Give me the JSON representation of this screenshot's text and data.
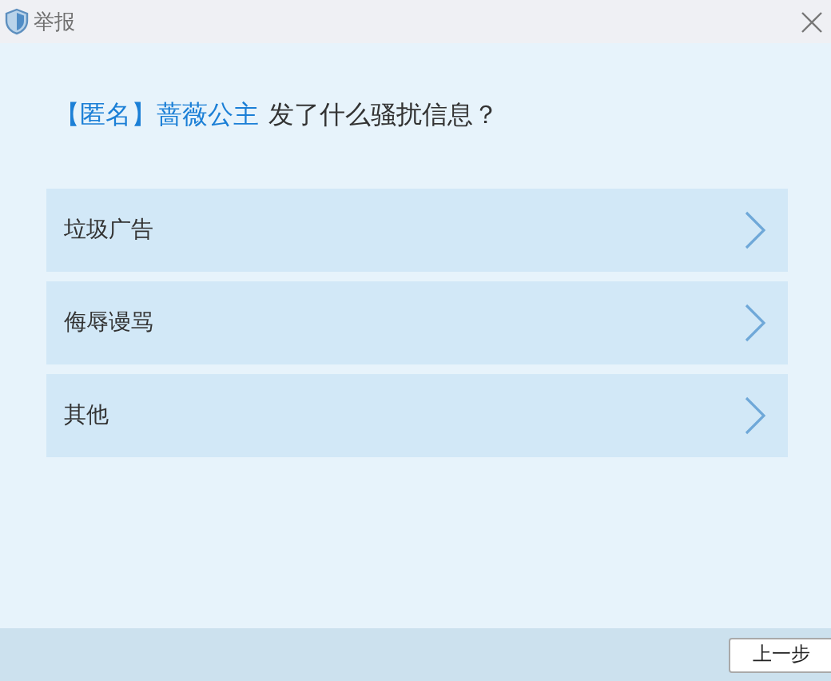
{
  "window": {
    "title": "举报"
  },
  "question": {
    "target": "【匿名】蔷薇公主",
    "text": "发了什么骚扰信息？"
  },
  "options": [
    {
      "label": "垃圾广告"
    },
    {
      "label": "侮辱谩骂"
    },
    {
      "label": "其他"
    }
  ],
  "buttons": [
    "上一步"
  ]
}
